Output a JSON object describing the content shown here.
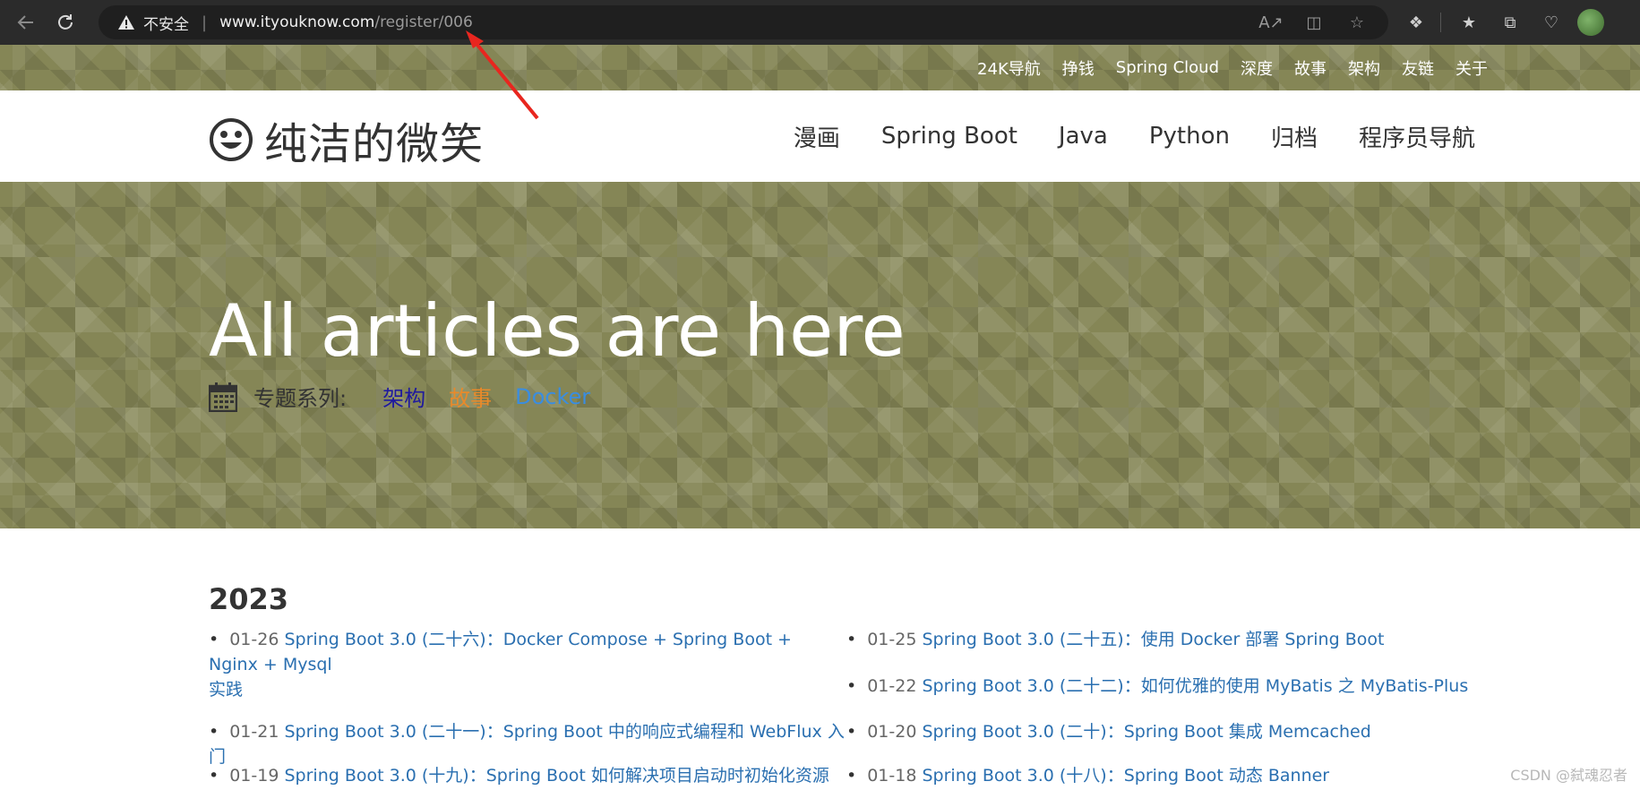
{
  "browser": {
    "insecure_label": "不安全",
    "url_host": "www.ityouknow.com",
    "url_path": "/register/006"
  },
  "topnav": {
    "items": [
      "24K导航",
      "挣钱",
      "Spring Cloud",
      "深度",
      "故事",
      "架构",
      "友链",
      "关于"
    ]
  },
  "header": {
    "brand": "纯洁的微笑",
    "nav": [
      "漫画",
      "Spring Boot",
      "Java",
      "Python",
      "归档",
      "程序员导航"
    ]
  },
  "hero": {
    "headline": "All articles are here",
    "topics_label": "专题系列:",
    "topics": [
      {
        "label": "架构",
        "color": "#1f1a9e"
      },
      {
        "label": "故事",
        "color": "#e88a2a"
      },
      {
        "label": "Docker",
        "color": "#3a8de0"
      }
    ]
  },
  "archive": {
    "year": "2023",
    "posts": [
      {
        "date": "01-26",
        "title": "Spring Boot 3.0 (二十六)：Docker Compose + Spring Boot + Nginx + Mysql",
        "title_cont": "实践"
      },
      {
        "date": "01-25",
        "title": "Spring Boot 3.0 (二十五)：使用 Docker 部署 Spring Boot"
      },
      {
        "date": "01-22",
        "title": "Spring Boot 3.0 (二十二)：如何优雅的使用 MyBatis 之 MyBatis-Plus"
      },
      {
        "date": "01-21",
        "title": "Spring Boot 3.0 (二十一)：Spring Boot 中的响应式编程和 WebFlux 入门"
      },
      {
        "date": "01-20",
        "title": "Spring Boot 3.0 (二十)：Spring Boot 集成 Memcached"
      },
      {
        "date": "01-19",
        "title": "Spring Boot 3.0 (十九)：Spring Boot 如何解决项目启动时初始化资源"
      },
      {
        "date": "01-18",
        "title": "Spring Boot 3.0 (十八)：Spring Boot 动态 Banner"
      }
    ]
  },
  "watermark": "CSDN @弑魂忍者"
}
